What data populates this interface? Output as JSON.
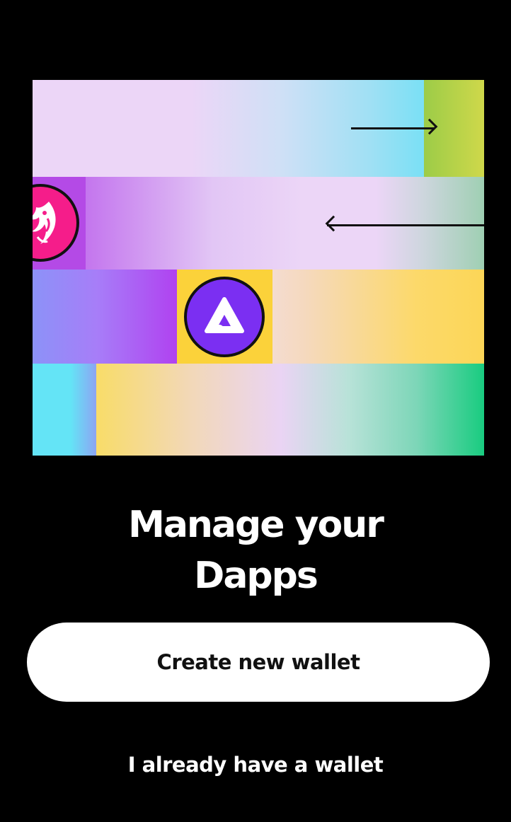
{
  "onboarding": {
    "title_line1": "Manage your",
    "title_line2": "Dapps",
    "primary_button_label": "Create new wallet",
    "secondary_link_label": "I already have a wallet"
  },
  "illustration": {
    "icons": [
      "uniswap-unicorn-icon",
      "audius-icon",
      "arrow-right-icon",
      "arrow-left-icon"
    ]
  },
  "colors": {
    "background": "#000000",
    "primary_button_bg": "#ffffff",
    "primary_button_text": "#111111",
    "text": "#ffffff",
    "pink_badge": "#f51d8a",
    "purple_badge": "#7b2ff2",
    "yellow_tile": "#fbd23a"
  }
}
